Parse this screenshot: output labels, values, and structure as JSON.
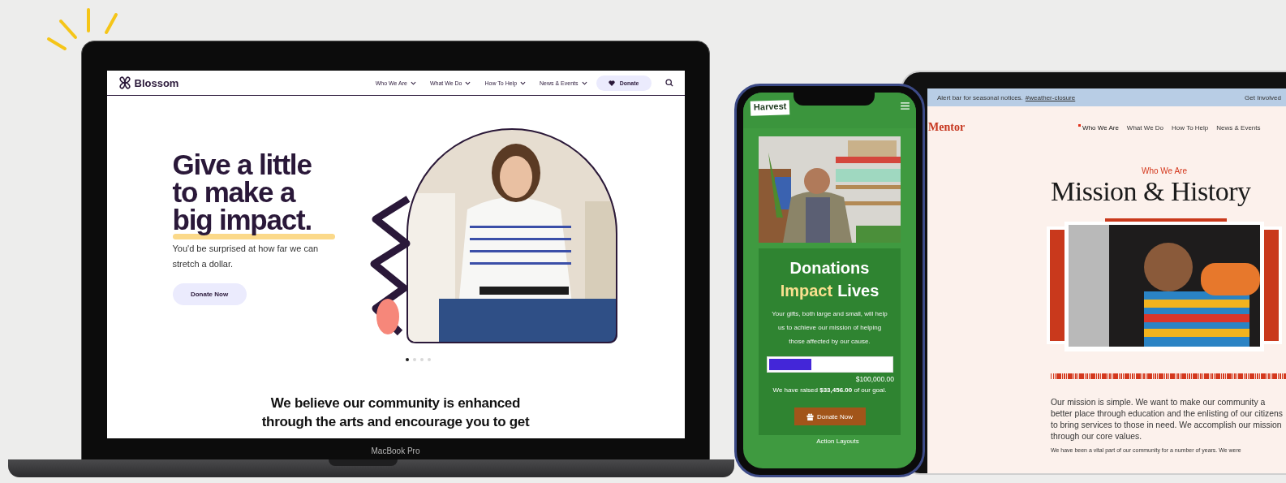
{
  "laptop": {
    "label": "MacBook Pro",
    "site": {
      "logo": "Blossom",
      "nav": [
        {
          "label": "Who We Are"
        },
        {
          "label": "What We Do"
        },
        {
          "label": "How To Help"
        },
        {
          "label": "News & Events"
        }
      ],
      "donate": "Donate",
      "headline": [
        "Give a little",
        "to make a",
        "big impact."
      ],
      "subtitle": "You'd be surprised at how far we can stretch a dollar.",
      "button": "Donate Now",
      "carousel": [
        {
          "selected": true
        },
        {
          "selected": false
        },
        {
          "selected": false
        },
        {
          "selected": false
        }
      ],
      "statement": "We believe our community is enhanced through the arts and encourage you to get"
    }
  },
  "phone": {
    "logo": "Harvest",
    "title": [
      {
        "text": "Donations",
        "highlight": false
      },
      {
        "text": "Impact",
        "highlight": true
      },
      {
        "text": "Lives",
        "highlight": false
      }
    ],
    "body": "Your gifts, both large and small, will help us to achieve our mission of helping those affected by our cause.",
    "progress": {
      "level": 0.35
    },
    "goal": "$100,000.00",
    "raised": "We have raised **$33,456.00** of our goal.",
    "button": "Donate Now",
    "next_section": "Action Layouts"
  },
  "tablet": {
    "alert": "Alert bar for seasonal notices.",
    "alert_link": "#weather-closure",
    "alert_action": "Get Involved",
    "logo": "Mentor",
    "nav": [
      {
        "label": "Who We Are",
        "selected": true
      },
      {
        "label": "What We Do",
        "selected": false
      },
      {
        "label": "How To Help",
        "selected": false
      },
      {
        "label": "News & Events",
        "selected": false
      }
    ],
    "eyebrow": "Who We Are",
    "title": "Mission & History",
    "paragraph": "Our mission is simple. We want to make our community a better place through education and the enlisting of our citizens to bring services to those in need. We accomplish our mission through our core values.",
    "paragraph_2": "We have been a vital part of our community for a number of years. We were"
  }
}
